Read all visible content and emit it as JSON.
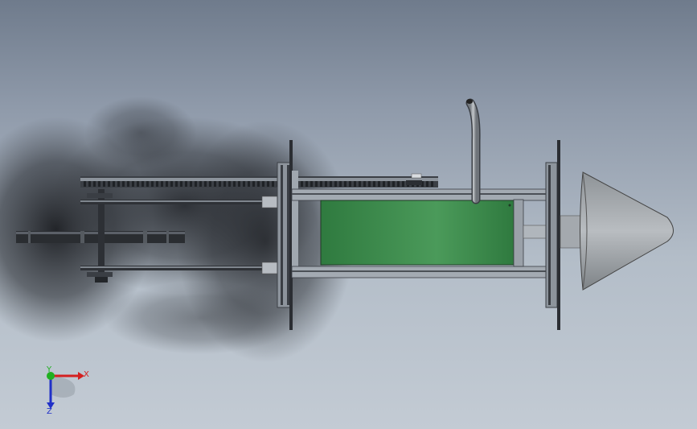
{
  "viewport": {
    "background_top": "#6f7b8c",
    "background_bottom": "#c3cbd4"
  },
  "model": {
    "parts": [
      "chain-drive",
      "frame-plate-left",
      "frame-plate-right",
      "tank",
      "exhaust-pipe",
      "nose-cone",
      "drive-shaft",
      "flywheel-bar",
      "tie-rod-upper",
      "tie-rod-lower",
      "rail-upper",
      "rail-lower"
    ],
    "colors": {
      "tank": "#3f8a4f",
      "metal": "#9aa3ad",
      "dark": "#2c2f34",
      "cone": "#a8adb2"
    }
  },
  "triad": {
    "x_label": "X",
    "y_label": "Y",
    "z_label": "Z",
    "x_color": "#d42020",
    "y_color": "#20b020",
    "z_color": "#2030c8"
  }
}
